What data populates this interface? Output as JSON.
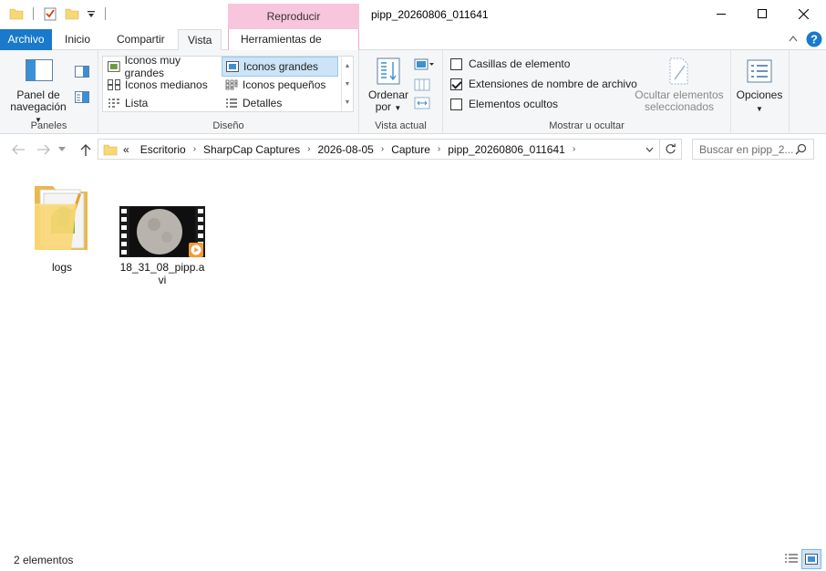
{
  "window": {
    "title": "pipp_20260806_011641",
    "context_group": "Reproducir"
  },
  "tabs": {
    "file": "Archivo",
    "home": "Inicio",
    "share": "Compartir",
    "view": "Vista",
    "video_tools": "Herramientas de vídeo"
  },
  "ribbon": {
    "panes": {
      "nav_pane_line1": "Panel de",
      "nav_pane_line2": "navegación",
      "label": "Paneles"
    },
    "layout": {
      "items": {
        "extra_large": "Iconos muy grandes",
        "large": "Iconos grandes",
        "medium": "Iconos medianos",
        "small": "Iconos pequeños",
        "list": "Lista",
        "details": "Detalles"
      },
      "label": "Diseño"
    },
    "current_view": {
      "sort_line1": "Ordenar",
      "sort_line2": "por",
      "label": "Vista actual"
    },
    "show_hide": {
      "item_checkboxes": "Casillas de elemento",
      "file_extensions": "Extensiones de nombre de archivo",
      "hidden_items": "Elementos ocultos",
      "hide_selected_line1": "Ocultar elementos",
      "hide_selected_line2": "seleccionados",
      "label": "Mostrar u ocultar",
      "item_checkboxes_checked": false,
      "file_extensions_checked": true,
      "hidden_items_checked": false
    },
    "options": "Opciones"
  },
  "address": {
    "overflow": "«",
    "crumbs": [
      "Escritorio",
      "SharpCap Captures",
      "2026-08-05",
      "Capture",
      "pipp_20260806_011641"
    ]
  },
  "search": {
    "placeholder": "Buscar en pipp_2..."
  },
  "files": [
    {
      "name": "logs",
      "type": "folder"
    },
    {
      "name": "18_31_08_pipp.avi",
      "type": "video"
    }
  ],
  "status": {
    "count": "2 elementos"
  },
  "colors": {
    "accent": "#1979ca",
    "context_tab": "#f7c6dc",
    "selection": "#cce4f7",
    "folder": "#f8d775"
  },
  "icons": [
    "folder-icon",
    "properties-icon",
    "new-folder-icon",
    "dropdown-icon",
    "minimize-icon",
    "maximize-icon",
    "close-icon",
    "help-icon",
    "nav-pane-icon",
    "preview-pane-icon",
    "details-pane-icon",
    "sort-icon",
    "group-by-icon",
    "add-columns-icon",
    "size-columns-icon",
    "hide-selected-icon",
    "options-icon",
    "back-arrow-icon",
    "forward-arrow-icon",
    "up-arrow-icon",
    "refresh-icon",
    "search-icon",
    "details-view-icon",
    "large-icons-view-icon"
  ]
}
